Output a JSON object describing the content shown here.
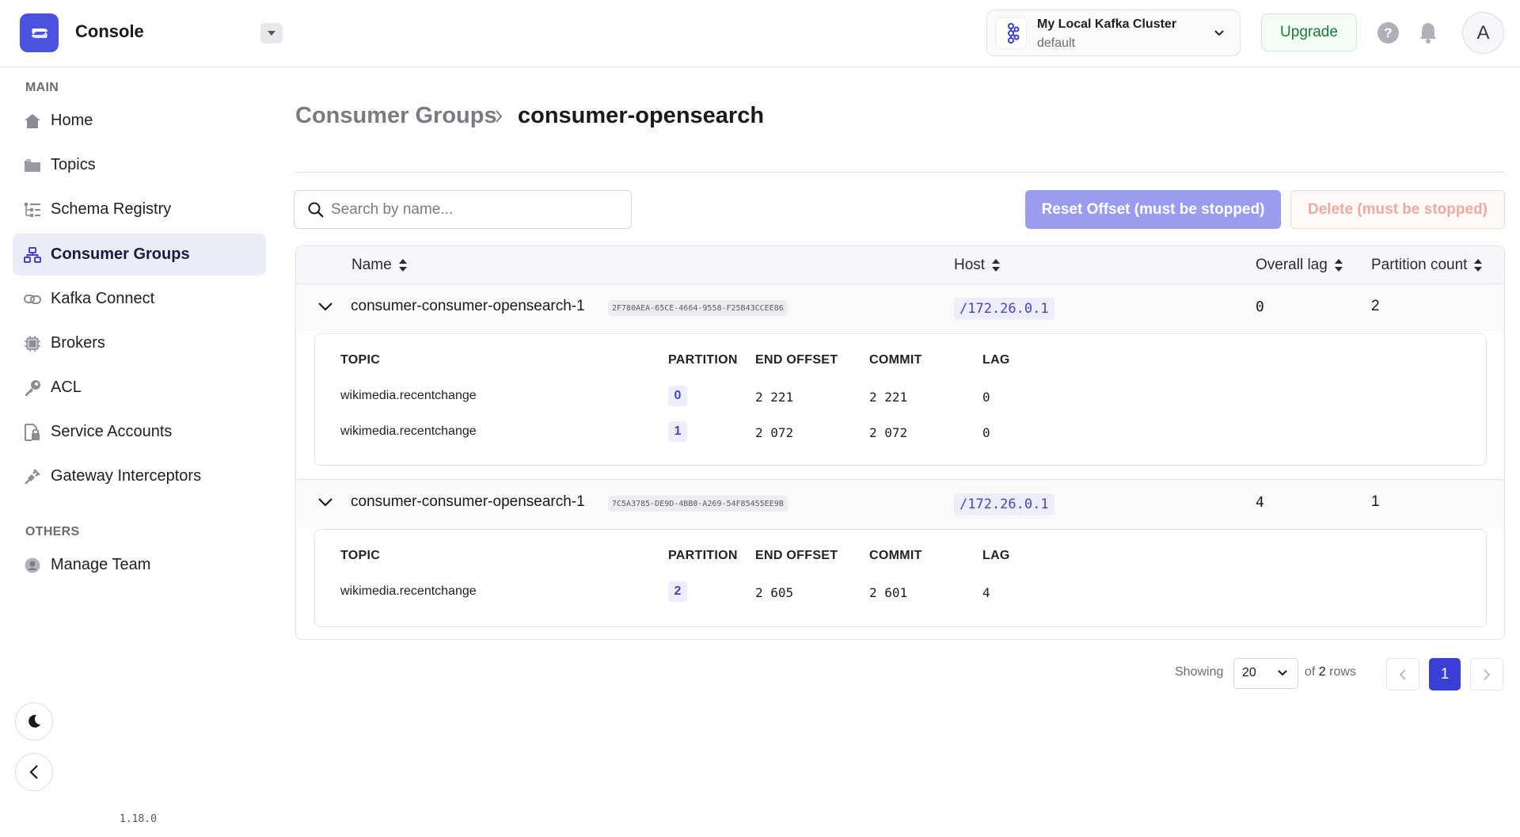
{
  "app": {
    "title": "Console",
    "version": "1.18.0"
  },
  "header": {
    "cluster": {
      "name": "My Local Kafka Cluster",
      "env": "default"
    },
    "upgrade_label": "Upgrade",
    "help_glyph": "?",
    "avatar_initial": "A"
  },
  "sidebar": {
    "main_label": "MAIN",
    "others_label": "OTHERS",
    "items": [
      {
        "label": "Home",
        "icon": "home-icon"
      },
      {
        "label": "Topics",
        "icon": "folder-icon"
      },
      {
        "label": "Schema Registry",
        "icon": "schema-icon"
      },
      {
        "label": "Consumer Groups",
        "icon": "consumer-groups-icon",
        "active": true
      },
      {
        "label": "Kafka Connect",
        "icon": "link-icon"
      },
      {
        "label": "Brokers",
        "icon": "chip-icon"
      },
      {
        "label": "ACL",
        "icon": "key-icon"
      },
      {
        "label": "Service Accounts",
        "icon": "lock-file-icon"
      },
      {
        "label": "Gateway Interceptors",
        "icon": "plug-icon"
      }
    ],
    "others": [
      {
        "label": "Manage Team",
        "icon": "user-icon"
      }
    ]
  },
  "breadcrumb": {
    "parent": "Consumer Groups",
    "current": "consumer-opensearch"
  },
  "search": {
    "placeholder": "Search by name...",
    "value": ""
  },
  "actions": {
    "reset": "Reset Offset (must be stopped)",
    "delete": "Delete (must be stopped)"
  },
  "table": {
    "columns": {
      "name": "Name",
      "host": "Host",
      "overall_lag": "Overall lag",
      "partition_count": "Partition count"
    },
    "sub_columns": {
      "topic": "TOPIC",
      "partition": "PARTITION",
      "end_offset": "END OFFSET",
      "commit": "COMMIT",
      "lag": "LAG"
    },
    "rows": [
      {
        "name": "consumer-consumer-opensearch-1",
        "id": "2F780AEA-65CE-4664-9558-F25B43CCEE86",
        "host": "/172.26.0.1",
        "overall_lag": "0",
        "partition_count": "2",
        "partitions": [
          {
            "topic": "wikimedia.recentchange",
            "partition": "0",
            "end_offset": "2 221",
            "commit": "2 221",
            "lag": "0"
          },
          {
            "topic": "wikimedia.recentchange",
            "partition": "1",
            "end_offset": "2 072",
            "commit": "2 072",
            "lag": "0"
          }
        ]
      },
      {
        "name": "consumer-consumer-opensearch-1",
        "id": "7C5A3785-DE9D-4BB0-A269-54F85455EE9B",
        "host": "/172.26.0.1",
        "overall_lag": "4",
        "partition_count": "1",
        "partitions": [
          {
            "topic": "wikimedia.recentchange",
            "partition": "2",
            "end_offset": "2 605",
            "commit": "2 601",
            "lag": "4"
          }
        ]
      }
    ]
  },
  "pagination": {
    "showing_label": "Showing",
    "page_size": "20",
    "of_label": "of",
    "total_rows": "2",
    "rows_label": "rows",
    "current_page": "1"
  },
  "colors": {
    "accent": "#4b52e0",
    "active_nav_bg": "#ececf8",
    "reset_btn": "#9b9cf0",
    "delete_text": "#eeaa9c",
    "upgrade_text": "#1b7a3a"
  }
}
